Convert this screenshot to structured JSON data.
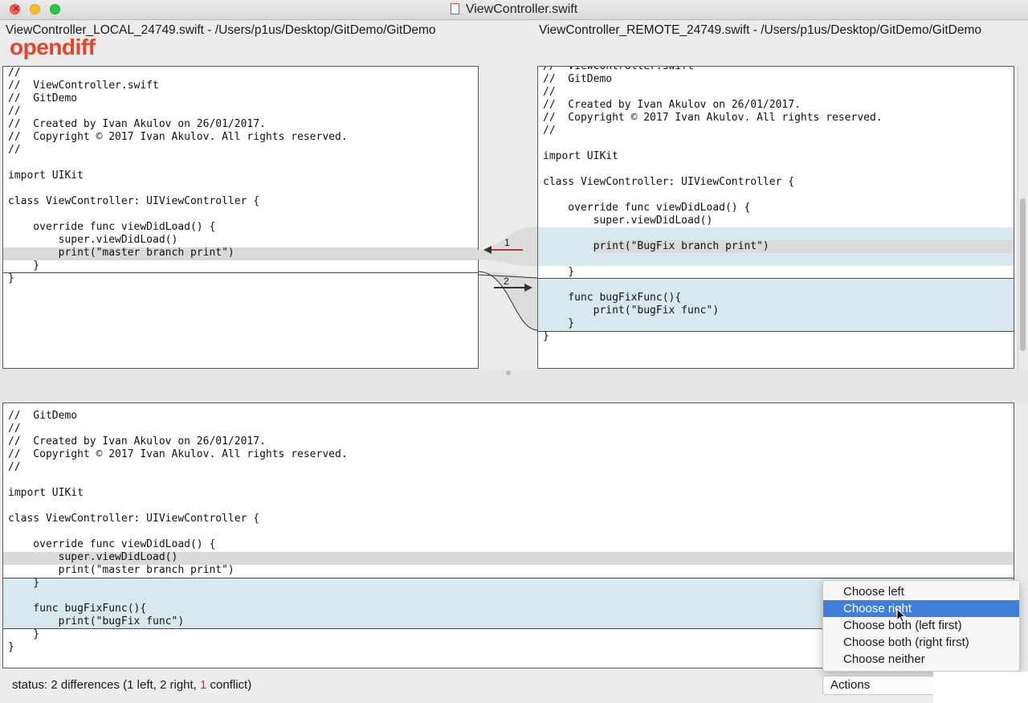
{
  "window": {
    "title": "ViewController.swift"
  },
  "paths": {
    "left": "ViewController_LOCAL_24749.swift - /Users/p1us/Desktop/GitDemo/GitDemo",
    "right": "ViewController_REMOTE_24749.swift - /Users/p1us/Desktop/GitDemo/GitDemo"
  },
  "watermark": "opendiff",
  "left_pane": [
    "//",
    "//  ViewController.swift",
    "//  GitDemo",
    "//",
    "//  Created by Ivan Akulov on 26/01/2017.",
    "//  Copyright © 2017 Ivan Akulov. All rights reserved.",
    "//",
    "",
    "import UIKit",
    "",
    "class ViewController: UIViewController {",
    "",
    "    override func viewDidLoad() {",
    "        super.viewDidLoad()",
    "        print(\"master branch print\")",
    "    }",
    "}"
  ],
  "right_pane": [
    "//  ViewController.swift",
    "//  GitDemo",
    "//",
    "//  Created by Ivan Akulov on 26/01/2017.",
    "//  Copyright © 2017 Ivan Akulov. All rights reserved.",
    "//",
    "",
    "import UIKit",
    "",
    "class ViewController: UIViewController {",
    "",
    "    override func viewDidLoad() {",
    "        super.viewDidLoad()",
    "",
    "        print(\"BugFix branch print\")",
    "",
    "    }",
    "",
    "    func bugFixFunc(){",
    "        print(\"bugFix func\")",
    "    }",
    "}"
  ],
  "merge_pane": [
    "//  GitDemo",
    "//",
    "//  Created by Ivan Akulov on 26/01/2017.",
    "//  Copyright © 2017 Ivan Akulov. All rights reserved.",
    "//",
    "",
    "import UIKit",
    "",
    "class ViewController: UIViewController {",
    "",
    "    override func viewDidLoad() {",
    "        super.viewDidLoad()",
    "        print(\"master branch print\")",
    "    }",
    "",
    "    func bugFixFunc(){",
    "        print(\"bugFix func\")",
    "    }",
    "}"
  ],
  "diff_markers": {
    "first": "1",
    "second": "2"
  },
  "menu": {
    "items": [
      "Choose left",
      "Choose right",
      "Choose both (left first)",
      "Choose both (right first)",
      "Choose neither"
    ],
    "selected": "Choose right"
  },
  "status": {
    "prefix": "status:  2 differences  (1 left,  2 right, ",
    "conflict_count": "1",
    "suffix": " conflict)"
  },
  "actions_label": "Actions",
  "colors": {
    "highlight_blue": "#d7e8f0",
    "highlight_gray": "#dadada",
    "arrow_red": "#c0392b",
    "menu_selected": "#3f7fd9",
    "watermark": "#e8432a"
  }
}
